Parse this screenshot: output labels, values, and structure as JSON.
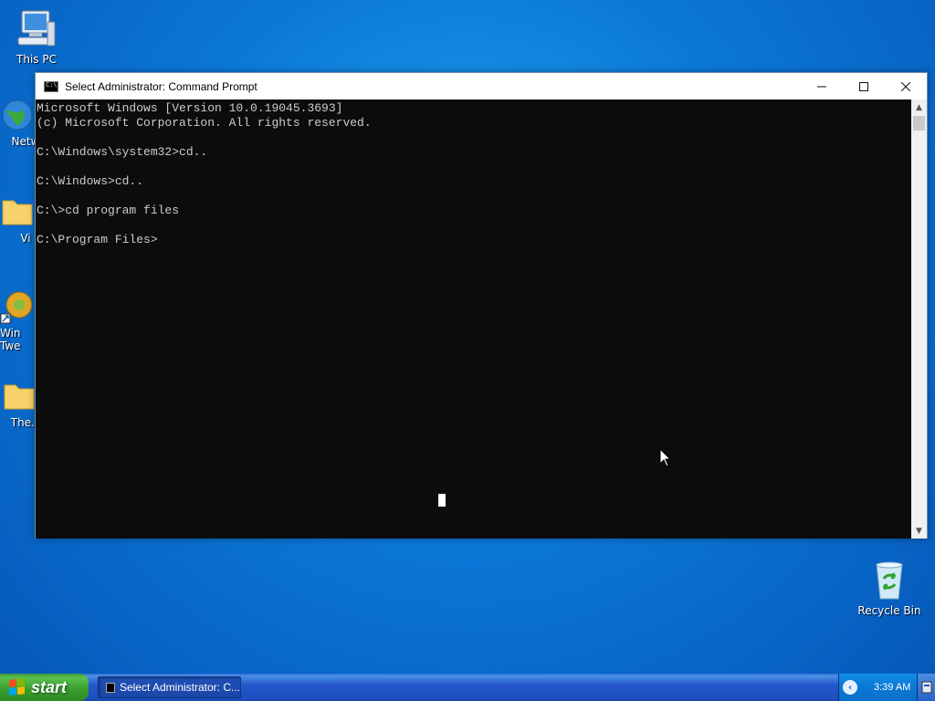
{
  "desktop": {
    "icons": [
      {
        "label": "This PC"
      },
      {
        "label": "Netw"
      },
      {
        "label": "Vi"
      },
      {
        "label": "Win Twe"
      },
      {
        "label": "The.C"
      },
      {
        "label": "Recycle Bin"
      }
    ]
  },
  "window": {
    "title": "Select Administrator: Command Prompt",
    "console_text": "Microsoft Windows [Version 10.0.19045.3693]\n(c) Microsoft Corporation. All rights reserved.\n\nC:\\Windows\\system32>cd..\n\nC:\\Windows>cd..\n\nC:\\>cd program files\n\nC:\\Program Files>"
  },
  "taskbar": {
    "start_label": "start",
    "task_label": "Select Administrator: C...",
    "clock": "3:39 AM"
  }
}
